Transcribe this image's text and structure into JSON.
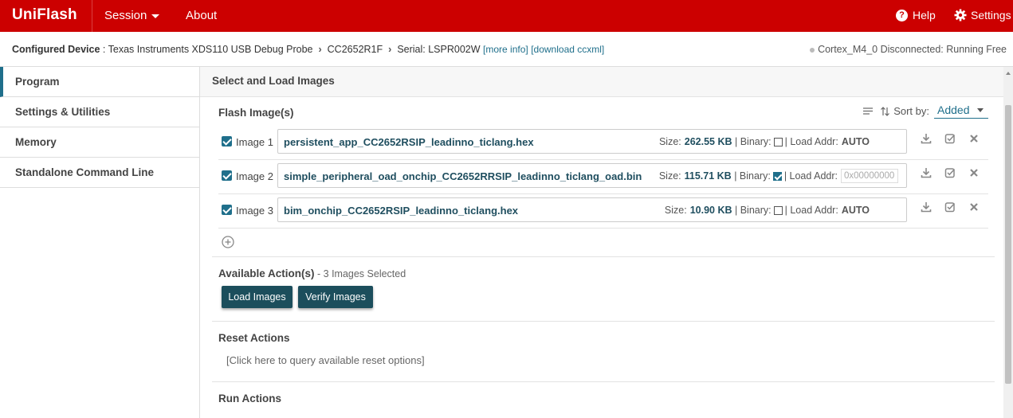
{
  "app": {
    "brand": "UniFlash",
    "menu": {
      "session": "Session",
      "about": "About"
    },
    "help": "Help",
    "settings": "Settings"
  },
  "device": {
    "configured_label": "Configured Device",
    "probe": "Texas Instruments XDS110 USB Debug Probe",
    "chip": "CC2652R1F",
    "serial": "Serial: LSPR002W",
    "more_info": "[more info]",
    "download": "[download ccxml]",
    "status": "Cortex_M4_0 Disconnected: Running Free"
  },
  "sidebar": {
    "items": [
      {
        "label": "Program",
        "active": true
      },
      {
        "label": "Settings & Utilities"
      },
      {
        "label": "Memory"
      },
      {
        "label": "Standalone Command Line"
      }
    ]
  },
  "main": {
    "header": "Select and Load Images",
    "flash_title": "Flash Image(s)",
    "sort_label": "Sort by:",
    "sort_value": "Added",
    "size_label": "Size:",
    "binary_label": "| Binary:",
    "load_addr_label": "| Load Addr:",
    "images": [
      {
        "label": "Image 1",
        "file": "persistent_app_CC2652RSIP_leadinno_ticlang.hex",
        "size": "262.55 KB",
        "binary": false,
        "load_addr": "AUTO"
      },
      {
        "label": "Image 2",
        "file": "simple_peripheral_oad_onchip_CC2652RRSIP_leadinno_ticlang_oad.bin",
        "size": "115.71 KB",
        "binary": true,
        "load_addr_placeholder": "0x00000000"
      },
      {
        "label": "Image 3",
        "file": "bim_onchip_CC2652RSIP_leadinno_ticlang.hex",
        "size": "10.90 KB",
        "binary": false,
        "load_addr": "AUTO"
      }
    ],
    "actions_title": "Available Action(s)",
    "actions_sub": " - 3 Images Selected",
    "load_button": "Load Images",
    "verify_button": "Verify Images",
    "reset_title": "Reset Actions",
    "reset_link": "[Click here to query available reset options]",
    "run_title": "Run Actions"
  },
  "colors": {
    "brand_red": "#cc0000",
    "accent_teal": "#1f6f8b",
    "button_dark": "#1c4e5c"
  }
}
